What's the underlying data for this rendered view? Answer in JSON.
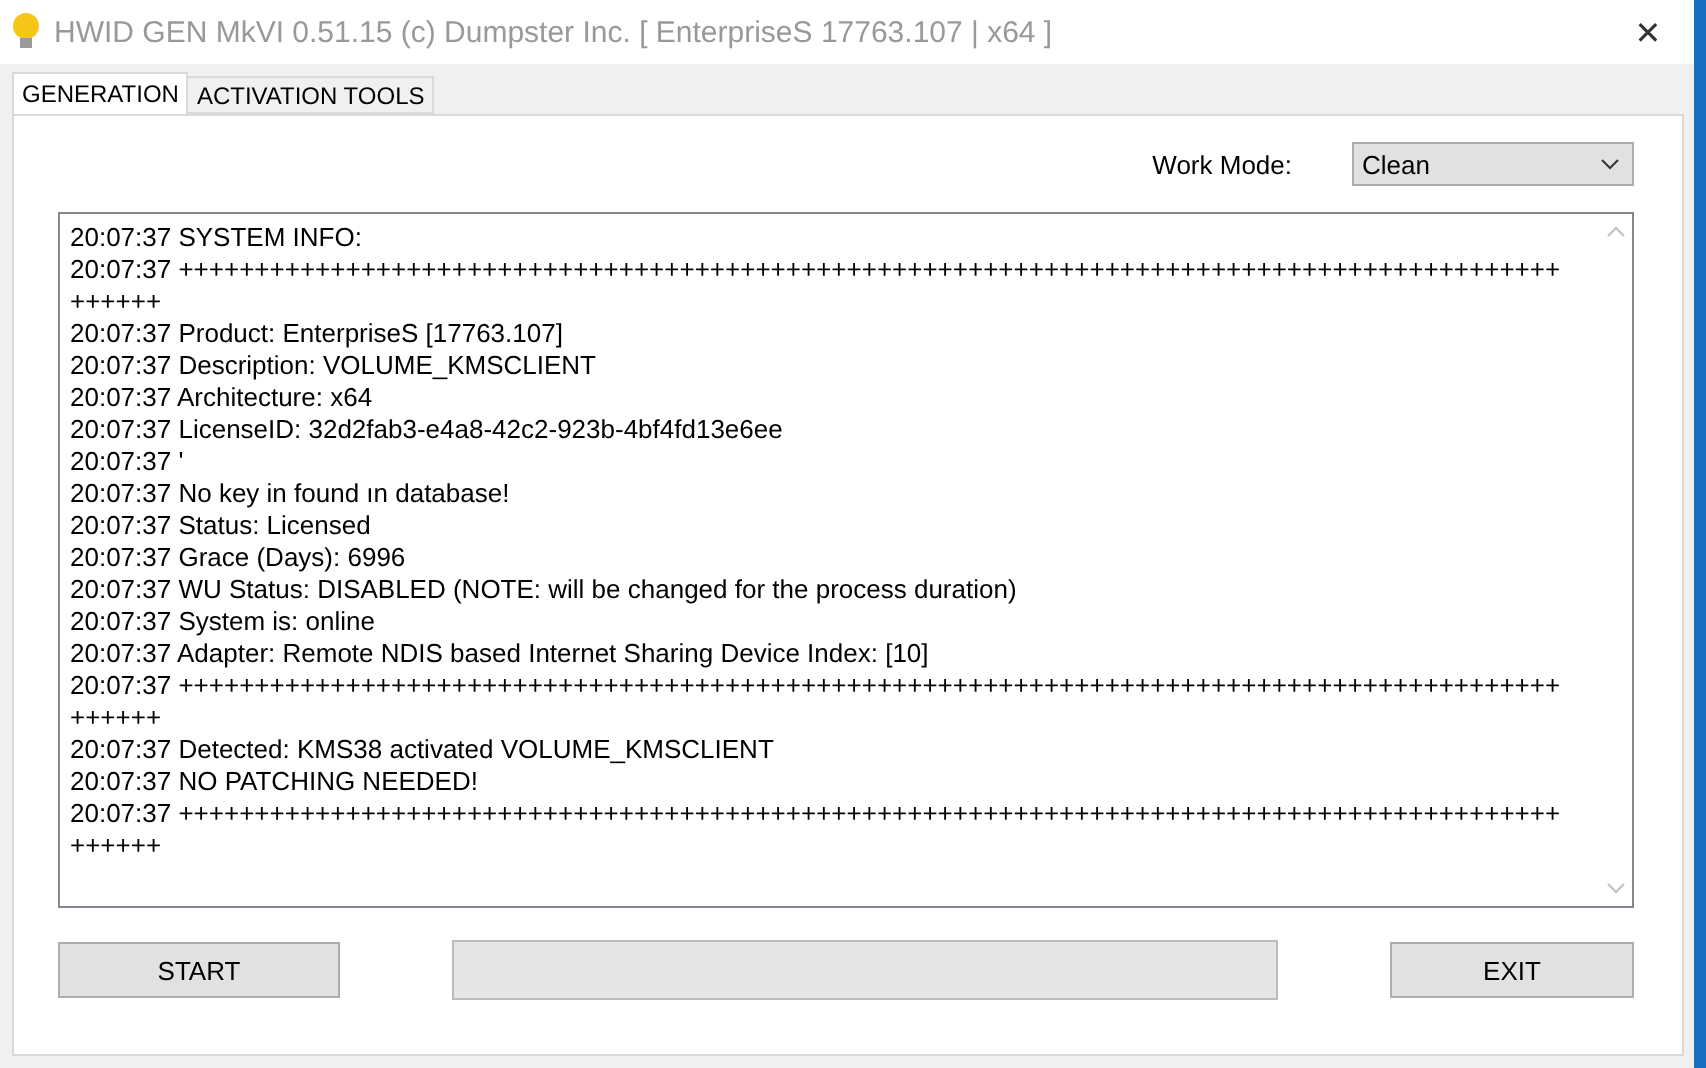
{
  "window": {
    "title": "HWID GEN MkVI 0.51.15 (c) Dumpster Inc. [ EnterpriseS 17763.107 | x64 ]",
    "close": "✕"
  },
  "tabs": [
    {
      "label": "GENERATION",
      "selected": true
    },
    {
      "label": "ACTIVATION TOOLS",
      "selected": false
    }
  ],
  "work_mode": {
    "label": "Work Mode:",
    "value": "Clean"
  },
  "log": [
    "20:07:37 SYSTEM INFO:",
    "20:07:37 +++++++++++++++++++++++++++++++++++++++++++++++++++++++++++++++++++++++++++++++++++++++++++",
    "++++++",
    "20:07:37 Product: EnterpriseS [17763.107]",
    "20:07:37 Description: VOLUME_KMSCLIENT",
    "20:07:37 Architecture: x64",
    "20:07:37 LicenseID: 32d2fab3-e4a8-42c2-923b-4bf4fd13e6ee",
    "20:07:37 '",
    "20:07:37 No key in found ın database!",
    "20:07:37 Status: Licensed",
    "20:07:37 Grace (Days): 6996",
    "20:07:37 WU Status: DISABLED (NOTE: will be changed for the process duration)",
    "20:07:37 System is: online",
    "20:07:37 Adapter: Remote NDIS based Internet Sharing Device Index: [10]",
    "20:07:37 +++++++++++++++++++++++++++++++++++++++++++++++++++++++++++++++++++++++++++++++++++++++++++",
    "++++++",
    "20:07:37 Detected: KMS38 activated VOLUME_KMSCLIENT",
    "20:07:37 NO PATCHING NEEDED!",
    "20:07:37 +++++++++++++++++++++++++++++++++++++++++++++++++++++++++++++++++++++++++++++++++++++++++++",
    "++++++"
  ],
  "start_button": "START",
  "exit_button": "EXIT"
}
